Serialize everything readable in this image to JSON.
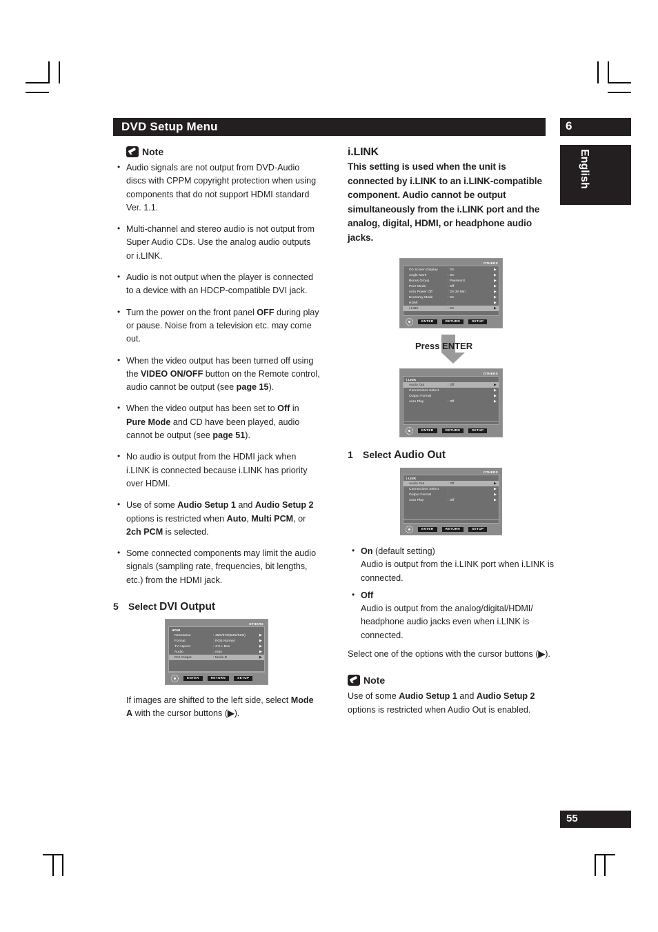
{
  "header": {
    "title": "DVD Setup Menu",
    "chapter": "6",
    "language_tab": "English"
  },
  "page_number": "55",
  "left_column": {
    "note": {
      "icon": "pencil-note-icon",
      "title": "Note",
      "bullets": [
        "Audio signals are not output from DVD-Audio discs with CPPM copyright protection when using components that do not support HDMI standard Ver. 1.1.",
        "Multi-channel and stereo audio is not output from Super Audio CDs. Use the analog audio outputs or i.LINK.",
        "Audio is not output when the player is connected to a device with an HDCP-compatible DVI jack.",
        "Turn the power on the front panel OFF during play or pause. Noise from a television etc. may come out.",
        "When the video output has been turned off using the VIDEO ON/OFF button on the Remote control, audio cannot be output (see page 15).",
        "When the video output has been set to Off in Pure Mode and CD have been played, audio cannot be output (see page 51).",
        "No audio is output from the HDMI jack when i.LINK is connected because i.LINK has priority over HDMI.",
        "Use of some Audio Setup 1 and Audio Setup 2 options is restricted when Auto, Multi PCM, or 2ch PCM is selected.",
        "Some connected components may limit the audio signals (sampling rate, frequencies, bit lengths, etc.) from the HDMI jack."
      ]
    },
    "step": {
      "number": "5",
      "verb": "Select",
      "target": "DVI Output"
    },
    "osd": {
      "tab": "OTHERS",
      "group": "HDMI",
      "rows": [
        {
          "label": "Resolution",
          "value": ": 480i/576i(525i/625i)",
          "selected": false
        },
        {
          "label": "Format",
          "value": ": RGB Normal",
          "selected": false
        },
        {
          "label": "TV Aspect",
          "value": ": 4:3 L-Box",
          "selected": false
        },
        {
          "label": "Audio",
          "value": ": Auto",
          "selected": false
        },
        {
          "label": "DVI Output",
          "value": ": Mode B",
          "selected": true
        }
      ],
      "keys": [
        "ENTER",
        "RETURN",
        "SETUP"
      ]
    },
    "caption": {
      "pre": "If images are shifted to the left side, select ",
      "bold1": "Mode A",
      "mid": " with the cursor buttons (",
      "cursor": "▶",
      "post": ")."
    }
  },
  "right_column": {
    "section_title": "i.LINK",
    "lead": "This setting is used when the unit is connected by i.LINK to an i.LINK-compatible component. Audio cannot be output simultaneously from the i.LINK port and the analog, digital, HDMI, or headphone audio jacks.",
    "osd_others": {
      "tab": "OTHERS",
      "rows": [
        {
          "label": "On Screen Display",
          "value": ": On",
          "selected": false
        },
        {
          "label": "Angle Mark",
          "value": ": On",
          "selected": false
        },
        {
          "label": "Bonus Group",
          "value": ": Password",
          "selected": false
        },
        {
          "label": "Pure Mode",
          "value": ": Off",
          "selected": false
        },
        {
          "label": "Auto Power Off",
          "value": ": On 30 Min",
          "selected": false
        },
        {
          "label": "Economy Mode",
          "value": ": On",
          "selected": false
        },
        {
          "label": "HDMI",
          "value": ":",
          "selected": false
        },
        {
          "label": "i.LINK",
          "value": ": On",
          "selected": true
        }
      ],
      "keys": [
        "ENTER",
        "RETURN",
        "SETUP"
      ]
    },
    "press_enter": "Press ENTER",
    "arrow": "down-arrow-icon",
    "osd_ilink_1": {
      "tab": "OTHERS",
      "group": "i.LINK",
      "rows": [
        {
          "label": "Audio Out",
          "value": ": Off",
          "selected": true
        },
        {
          "label": "Connections Select",
          "value": ":",
          "selected": false
        },
        {
          "label": "Output Format",
          "value": ":",
          "selected": false
        },
        {
          "label": "Auto Play",
          "value": ": Off",
          "selected": false
        }
      ],
      "keys": [
        "ENTER",
        "RETURN",
        "SETUP"
      ]
    },
    "step": {
      "number": "1",
      "verb": "Select",
      "target": "Audio Out"
    },
    "osd_ilink_2": {
      "tab": "OTHERS",
      "group": "i.LINK",
      "rows": [
        {
          "label": "Audio Out",
          "value": ": Off",
          "selected": true
        },
        {
          "label": "Connections Select",
          "value": ":",
          "selected": false
        },
        {
          "label": "Output Format",
          "value": ":",
          "selected": false
        },
        {
          "label": "Auto Play",
          "value": ": Off",
          "selected": false
        }
      ],
      "keys": [
        "ENTER",
        "RETURN",
        "SETUP"
      ]
    },
    "options": [
      {
        "name": "On",
        "suffix": " (default setting)",
        "desc": "Audio is output from the i.LINK port when i.LINK is connected."
      },
      {
        "name": "Off",
        "suffix": "",
        "desc": "Audio is output from the analog/digital/HDMI/ headphone audio jacks even when i.LINK is connected."
      }
    ],
    "select_note": {
      "pre": "Select one of the options with the cursor buttons (",
      "cursor": "▶",
      "post": ")."
    },
    "note": {
      "icon": "pencil-note-icon",
      "title": "Note",
      "text_pre": "Use of some ",
      "bold1": "Audio Setup 1",
      "text_mid": " and ",
      "bold2": "Audio Setup 2",
      "text_post": " options is restricted when Audio Out is enabled."
    }
  }
}
